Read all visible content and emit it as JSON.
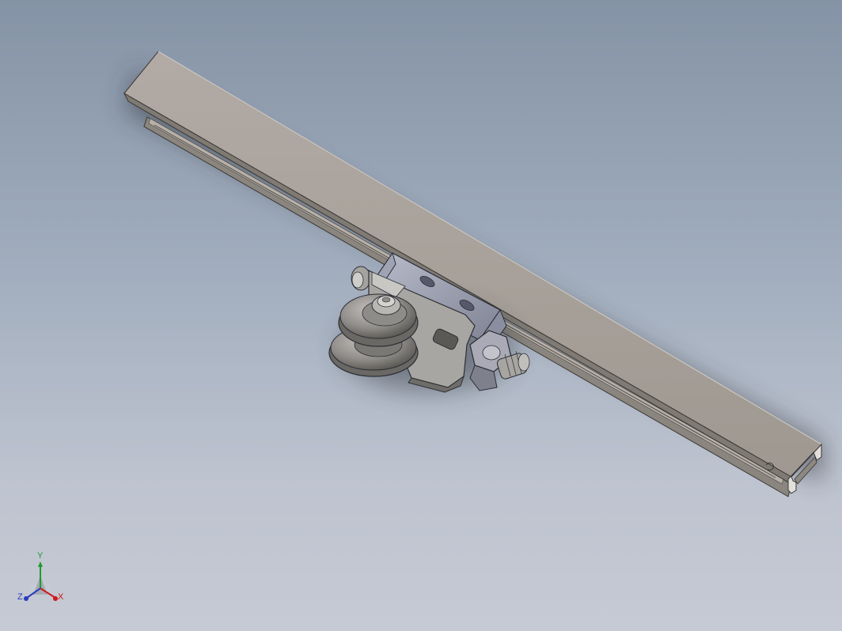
{
  "viewport": {
    "model": "rail-trolley-assembly",
    "background": {
      "top": "#8593a6",
      "bottom": "#c6cad4"
    }
  },
  "triad": {
    "x_label": "X",
    "y_label": "Y",
    "z_label": "Z",
    "colors": {
      "x": "#d0191b",
      "y": "#1f9a2c",
      "z": "#2a3dbd"
    }
  }
}
